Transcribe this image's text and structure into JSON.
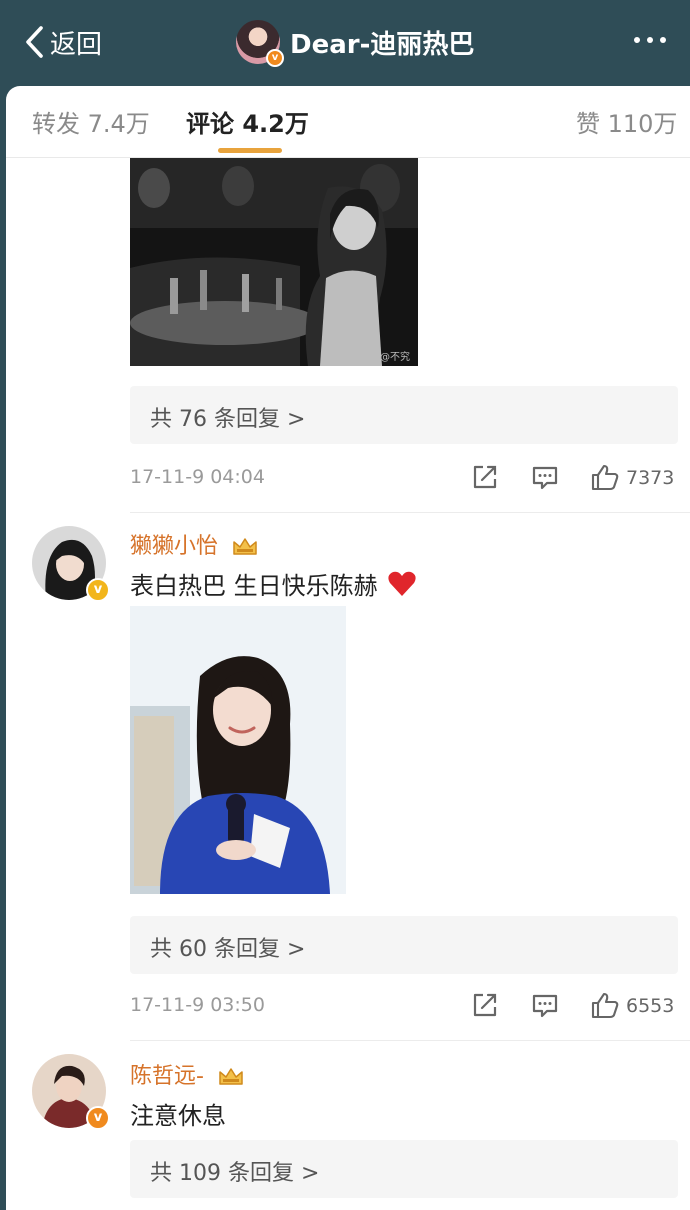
{
  "header": {
    "back_label": "返回",
    "title": "Dear-迪丽热巴",
    "verified_badge": "v"
  },
  "tabs": [
    {
      "label": "转发 7.4万"
    },
    {
      "label": "评论 4.2万",
      "active": true
    },
    {
      "label": "赞 110万"
    }
  ],
  "comments": [
    {
      "replies_label": "共 76 条回复 >",
      "timestamp": "17-11-9 04:04",
      "likes": "7373",
      "image_watermark": "@不究"
    },
    {
      "username": "獭獭小怡",
      "badge": "v",
      "text": "表白热巴 生日快乐陈赫",
      "emoji": "❤️",
      "replies_label": "共 60 条回复 >",
      "timestamp": "17-11-9 03:50",
      "likes": "6553"
    },
    {
      "username": "陈哲远-",
      "badge": "v",
      "text": "注意休息",
      "replies_label": "共 109 条回复 >"
    }
  ],
  "colors": {
    "header_bg": "#2f4d57",
    "accent": "#e8a33c",
    "username": "#d6732a",
    "badge_yellow": "#f2b51b",
    "badge_orange": "#f08a1e"
  }
}
